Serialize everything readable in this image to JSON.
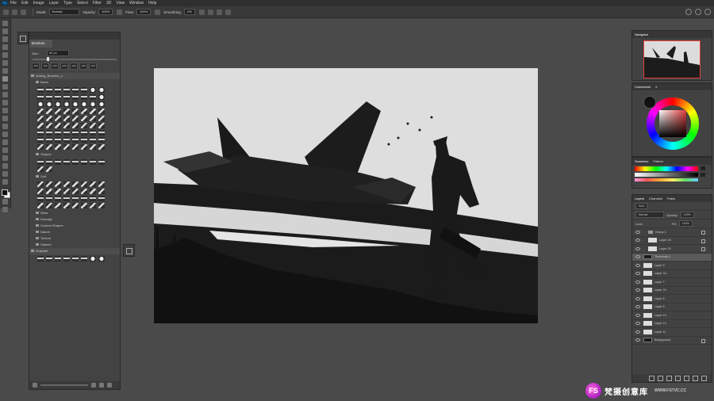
{
  "menubar": {
    "app_icon": "Ps",
    "items": [
      "File",
      "Edit",
      "Image",
      "Layer",
      "Type",
      "Select",
      "Filter",
      "3D",
      "View",
      "Window",
      "Help"
    ]
  },
  "options_bar": {
    "mode_label": "Mode:",
    "mode_value": "Normal",
    "opacity_label": "Opacity:",
    "opacity_value": "100%",
    "flow_label": "Flow:",
    "flow_value": "100%",
    "smoothing_label": "Smoothing:",
    "smoothing_value": "0%"
  },
  "brushes_panel": {
    "title": "Brushes",
    "size_label": "Size:",
    "size_value": "60 px",
    "recent_sizes": [
      "125",
      "125",
      "125",
      "125",
      "125",
      "125",
      "125"
    ],
    "root_folder": "Analog_Brushes_v...",
    "folders": [
      {
        "name": "Basic",
        "level": 1
      },
      {
        "name": "Shapes",
        "level": 1
      },
      {
        "name": "Soft",
        "level": 1
      },
      {
        "name": "Wear",
        "level": 1
      },
      {
        "name": "Smudge",
        "level": 1
      },
      {
        "name": "Custom Shapes",
        "level": 1
      },
      {
        "name": "Nature",
        "level": 1
      },
      {
        "name": "Texture",
        "level": 1
      },
      {
        "name": "Stained",
        "level": 1
      },
      {
        "name": "Graphite",
        "level": 0
      }
    ]
  },
  "navigator": {
    "title": "Navigator"
  },
  "color_panel": {
    "tabs": [
      "Colorwheel",
      "X"
    ],
    "active": "Colorwheel"
  },
  "swatches_panel": {
    "tabs": [
      "Swatches",
      "Pattern"
    ]
  },
  "layers_panel": {
    "tabs": [
      "Layers",
      "Channels",
      "Paths"
    ],
    "kind_label": "Kind",
    "blend_mode": "Normal",
    "opacity_label": "Opacity:",
    "opacity_value": "100%",
    "lock_label": "Lock:",
    "fill_label": "Fill:",
    "fill_value": "100%",
    "layers": [
      {
        "name": "Group 1",
        "type": "group",
        "selected": false
      },
      {
        "name": "Layer 20",
        "type": "layer",
        "selected": false
      },
      {
        "name": "Layer 20",
        "type": "layer",
        "selected": false
      },
      {
        "name": "Threshold 1",
        "type": "adjust",
        "selected": true
      },
      {
        "name": "Layer 5",
        "type": "layer",
        "selected": false
      },
      {
        "name": "Layer 7b",
        "type": "layer",
        "selected": false
      },
      {
        "name": "Layer 7",
        "type": "layer",
        "selected": false
      },
      {
        "name": "Layer 7b",
        "type": "layer",
        "selected": false
      },
      {
        "name": "Layer 6",
        "type": "layer",
        "selected": false
      },
      {
        "name": "Layer 5",
        "type": "layer",
        "selected": false
      },
      {
        "name": "Layer 13",
        "type": "layer",
        "selected": false
      },
      {
        "name": "Layer 12",
        "type": "layer",
        "selected": false
      },
      {
        "name": "Layer 11",
        "type": "layer",
        "selected": false
      },
      {
        "name": "Background",
        "type": "background",
        "selected": false
      }
    ]
  },
  "watermark": {
    "logo_text": "FS",
    "chinese": "梵摄创意库",
    "url": "WWW.FSTVC.CC"
  },
  "colors": {
    "workspace": "#4a4a4a",
    "panel": "#424242",
    "accent_selection": "#e0403a"
  }
}
